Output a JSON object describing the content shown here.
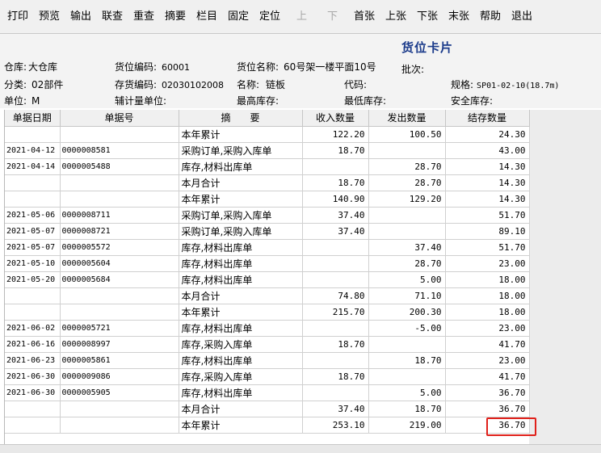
{
  "toolbar": {
    "print": "打印",
    "preview": "预览",
    "export": "输出",
    "linked_query": "联查",
    "requery": "重查",
    "summary": "摘要",
    "columns": "栏目",
    "pin": "固定",
    "locate": "定位",
    "up": "上",
    "down": "下",
    "first": "首张",
    "prev": "上张",
    "next": "下张",
    "last": "末张",
    "help": "帮助",
    "exit": "退出"
  },
  "header": {
    "title": "货位卡片",
    "batch_label": "批次:",
    "batch_value": "",
    "warehouse_label": "仓库:",
    "warehouse_value": "大仓库",
    "location_code_label": "货位编码:",
    "location_code_value": "60001",
    "location_name_label": "货位名称:",
    "location_name_value": "60号架一楼平面10号",
    "category_label": "分类:",
    "category_value": "02部件",
    "inventory_code_label": "存货编码:",
    "inventory_code_value": "02030102008",
    "name_label": "名称:",
    "name_value": "链板",
    "code_label": "代码:",
    "code_value": "",
    "spec_label": "规格:",
    "spec_value": "SP01-02-10(18.7m)",
    "unit_label": "单位:",
    "unit_value": "M",
    "aux_unit_label": "辅计量单位:",
    "aux_unit_value": "",
    "max_stock_label": "最高库存:",
    "max_stock_value": "",
    "min_stock_label": "最低库存:",
    "min_stock_value": "",
    "safety_stock_label": "安全库存:",
    "safety_stock_value": ""
  },
  "table": {
    "columns": [
      "单据日期",
      "单据号",
      "摘　　要",
      "收入数量",
      "发出数量",
      "结存数量"
    ],
    "rows": [
      {
        "date": "",
        "bill": "",
        "summary": "本年累计",
        "in": "122.20",
        "out": "100.50",
        "balance": "24.30"
      },
      {
        "date": "2021-04-12",
        "bill": "0000008581",
        "summary": "采购订单,采购入库单",
        "in": "18.70",
        "out": "",
        "balance": "43.00"
      },
      {
        "date": "2021-04-14",
        "bill": "0000005488",
        "summary": "库存,材料出库单",
        "in": "",
        "out": "28.70",
        "balance": "14.30"
      },
      {
        "date": "",
        "bill": "",
        "summary": "本月合计",
        "in": "18.70",
        "out": "28.70",
        "balance": "14.30"
      },
      {
        "date": "",
        "bill": "",
        "summary": "本年累计",
        "in": "140.90",
        "out": "129.20",
        "balance": "14.30"
      },
      {
        "date": "2021-05-06",
        "bill": "0000008711",
        "summary": "采购订单,采购入库单",
        "in": "37.40",
        "out": "",
        "balance": "51.70"
      },
      {
        "date": "2021-05-07",
        "bill": "0000008721",
        "summary": "采购订单,采购入库单",
        "in": "37.40",
        "out": "",
        "balance": "89.10"
      },
      {
        "date": "2021-05-07",
        "bill": "0000005572",
        "summary": "库存,材料出库单",
        "in": "",
        "out": "37.40",
        "balance": "51.70"
      },
      {
        "date": "2021-05-10",
        "bill": "0000005604",
        "summary": "库存,材料出库单",
        "in": "",
        "out": "28.70",
        "balance": "23.00"
      },
      {
        "date": "2021-05-20",
        "bill": "0000005684",
        "summary": "库存,材料出库单",
        "in": "",
        "out": "5.00",
        "balance": "18.00"
      },
      {
        "date": "",
        "bill": "",
        "summary": "本月合计",
        "in": "74.80",
        "out": "71.10",
        "balance": "18.00"
      },
      {
        "date": "",
        "bill": "",
        "summary": "本年累计",
        "in": "215.70",
        "out": "200.30",
        "balance": "18.00"
      },
      {
        "date": "2021-06-02",
        "bill": "0000005721",
        "summary": "库存,材料出库单",
        "in": "",
        "out": "-5.00",
        "balance": "23.00"
      },
      {
        "date": "2021-06-16",
        "bill": "0000008997",
        "summary": "库存,采购入库单",
        "in": "18.70",
        "out": "",
        "balance": "41.70"
      },
      {
        "date": "2021-06-23",
        "bill": "0000005861",
        "summary": "库存,材料出库单",
        "in": "",
        "out": "18.70",
        "balance": "23.00"
      },
      {
        "date": "2021-06-30",
        "bill": "0000009086",
        "summary": "库存,采购入库单",
        "in": "18.70",
        "out": "",
        "balance": "41.70"
      },
      {
        "date": "2021-06-30",
        "bill": "0000005905",
        "summary": "库存,材料出库单",
        "in": "",
        "out": "5.00",
        "balance": "36.70"
      },
      {
        "date": "",
        "bill": "",
        "summary": "本月合计",
        "in": "37.40",
        "out": "18.70",
        "balance": "36.70"
      },
      {
        "date": "",
        "bill": "",
        "summary": "本年累计",
        "in": "253.10",
        "out": "219.00",
        "balance": "36.70"
      }
    ]
  },
  "highlight_color": "#e0201a"
}
